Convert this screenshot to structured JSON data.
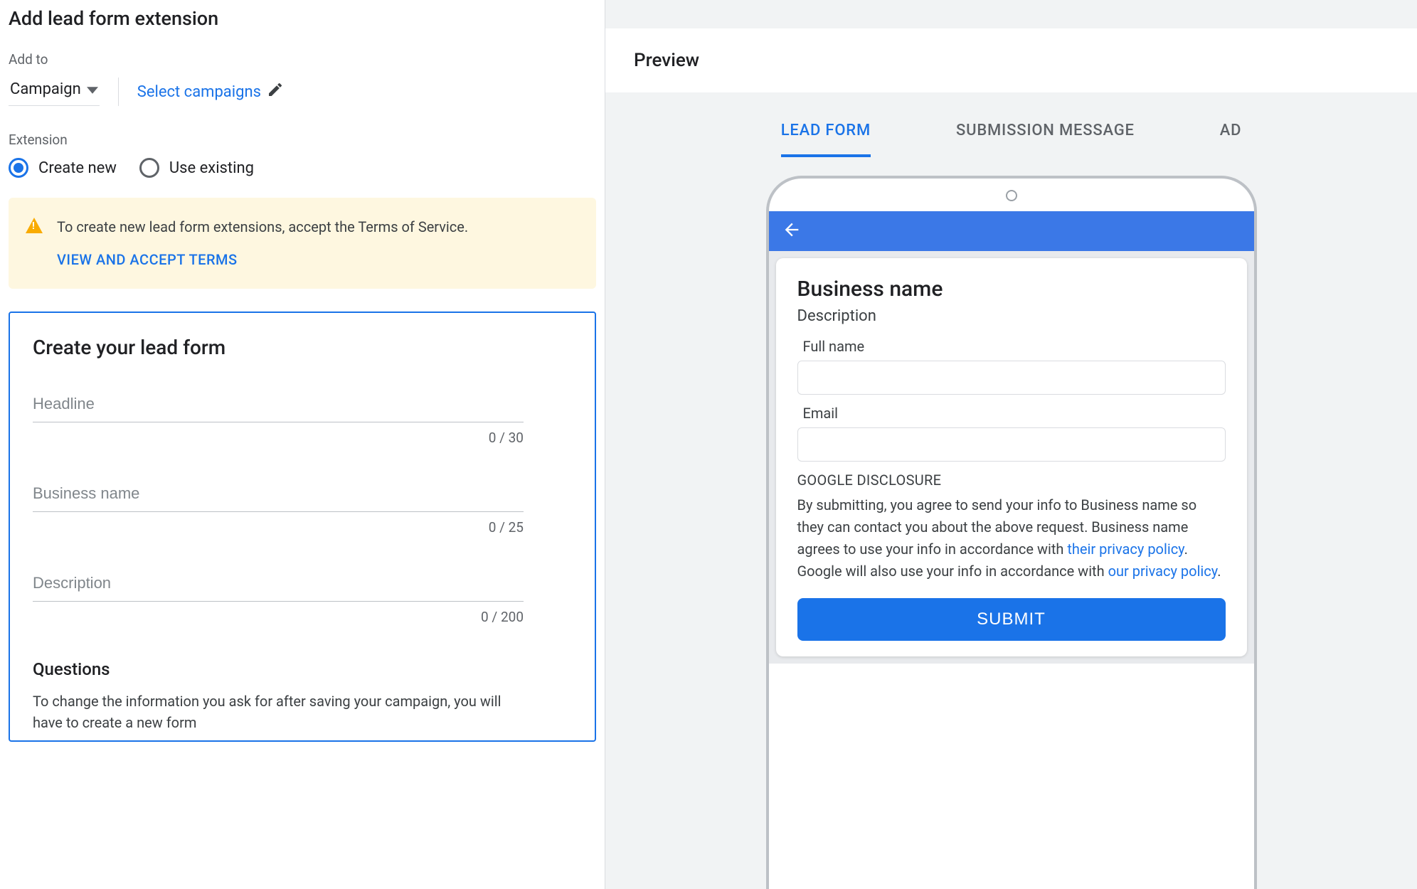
{
  "header": {
    "title": "Add lead form extension"
  },
  "addto": {
    "label": "Add to",
    "selected": "Campaign",
    "select_link": "Select campaigns"
  },
  "extension": {
    "label": "Extension",
    "options": {
      "create_new": "Create new",
      "use_existing": "Use existing"
    }
  },
  "notice": {
    "body": "To create new lead form extensions, accept the Terms of Service.",
    "link": "VIEW AND ACCEPT TERMS"
  },
  "form": {
    "title": "Create your lead form",
    "fields": {
      "headline": {
        "placeholder": "Headline",
        "counter": "0 / 30"
      },
      "business_name": {
        "placeholder": "Business name",
        "counter": "0 / 25"
      },
      "description": {
        "placeholder": "Description",
        "counter": "0 / 200"
      }
    },
    "questions": {
      "heading": "Questions",
      "body": "To change the information you ask for after saving your campaign, you will have to create a new form"
    }
  },
  "preview": {
    "title": "Preview",
    "tabs": {
      "lead_form": "LEAD FORM",
      "submission": "SUBMISSION MESSAGE",
      "ad": "AD"
    },
    "phone": {
      "business_name": "Business name",
      "description": "Description",
      "fullname_label": "Full name",
      "email_label": "Email",
      "disclosure_heading": "GOOGLE DISCLOSURE",
      "disclosure_pre": "By submitting, you agree to send your info to Business name so they can contact you about the above request. Business name agrees to use your info in accordance with ",
      "their_policy": "their privacy policy",
      "disclosure_mid": ". Google will also use your info in accordance with ",
      "our_policy": "our privacy policy",
      "disclosure_end": ".",
      "submit": "SUBMIT"
    }
  }
}
